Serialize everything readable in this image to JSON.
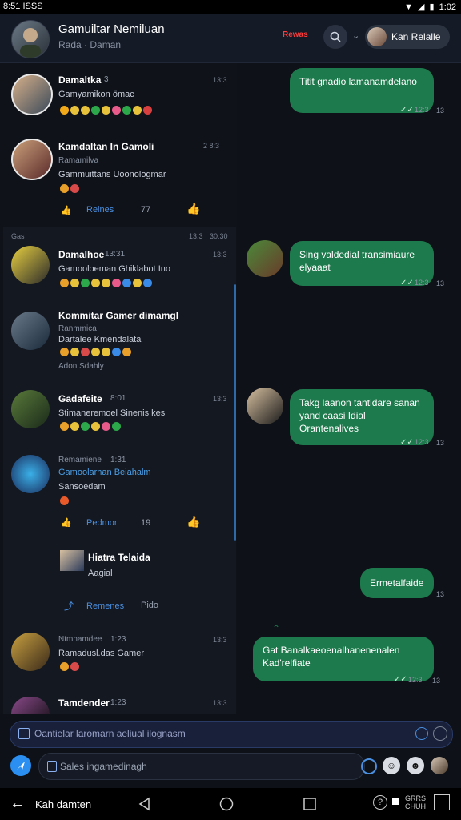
{
  "status": {
    "time_left": "8:51 ISSS",
    "time_right": "1:02"
  },
  "header": {
    "title": "Gamuiltar Nemiluan",
    "subtitle": "Rada · Daman",
    "badge": "Rewas",
    "user_name": "Kan Relalle"
  },
  "comments": [
    {
      "name": "Damaltka",
      "meta": "3",
      "text": "Gamyamikon ömac",
      "ts": "13:3"
    },
    {
      "name": "Kamdaltan In Gamoli",
      "meta": "Ramamilva",
      "text": "Gammuittans Uoonologmar",
      "ts": "13:3",
      "badge_ts": "2 8:3"
    },
    {
      "name": "Damalhoe",
      "meta": "13:31",
      "text": "Gamooloeman Ghiklabot Ino",
      "ts": "13:3"
    },
    {
      "name": "Kommitar Gamer dimamgl",
      "meta": "Ranmmica",
      "text": "Dartalee Kmendalata",
      "extra": "Adon Sdahly"
    },
    {
      "name": "Gadafeite",
      "meta": "8:01",
      "text": "Stimaneremoel Sinenis kes",
      "ts": "13:3"
    },
    {
      "name": "Remamiene",
      "meta": "1:31",
      "text": "Gamoolarhan Beiahalm",
      "extra": "Sansoedam"
    },
    {
      "name": "Hiatra Telaida",
      "meta": "",
      "text": "Aagial",
      "ts": ""
    },
    {
      "name": "Ntmnamdee",
      "meta": "1:23",
      "text": "Ramadusl.das Gamer",
      "ts": "13:3"
    },
    {
      "name": "Tamdender",
      "meta": "1:23",
      "text": "",
      "ts": "13:3"
    }
  ],
  "panel_header": {
    "left": "Gas",
    "ts1": "13:3",
    "ts2": "30:30"
  },
  "actions": {
    "reply1": "Reines",
    "react1": "77",
    "reply2": "Pedmor",
    "react2": "19",
    "reply3": "Remenes",
    "react3": "Pido"
  },
  "messages": [
    {
      "text": "Titit gnadio lamanamdelano",
      "ts": "12:3",
      "side": "13"
    },
    {
      "text": "Sing valdedial transimiaure elyaaat",
      "ts": "12:3",
      "side": "13"
    },
    {
      "text": "Takg laanon tantidare sanan yand caasi Idial Orantenalives",
      "ts": "12:3",
      "side": "13"
    },
    {
      "text": "Ermetalfaide",
      "ts": "",
      "side": "13"
    },
    {
      "text": "Gat Banalkaeoenalhanenenalen Kad'relfiate",
      "ts": "12:3",
      "side": "13"
    }
  ],
  "composer": {
    "placeholder1": "Oantielar laromarn aeliual ilognasm",
    "placeholder2": "Sales ingamedinagh"
  },
  "nav": {
    "back_label": "Kah damten",
    "right_label": "GRRS CHUH"
  }
}
